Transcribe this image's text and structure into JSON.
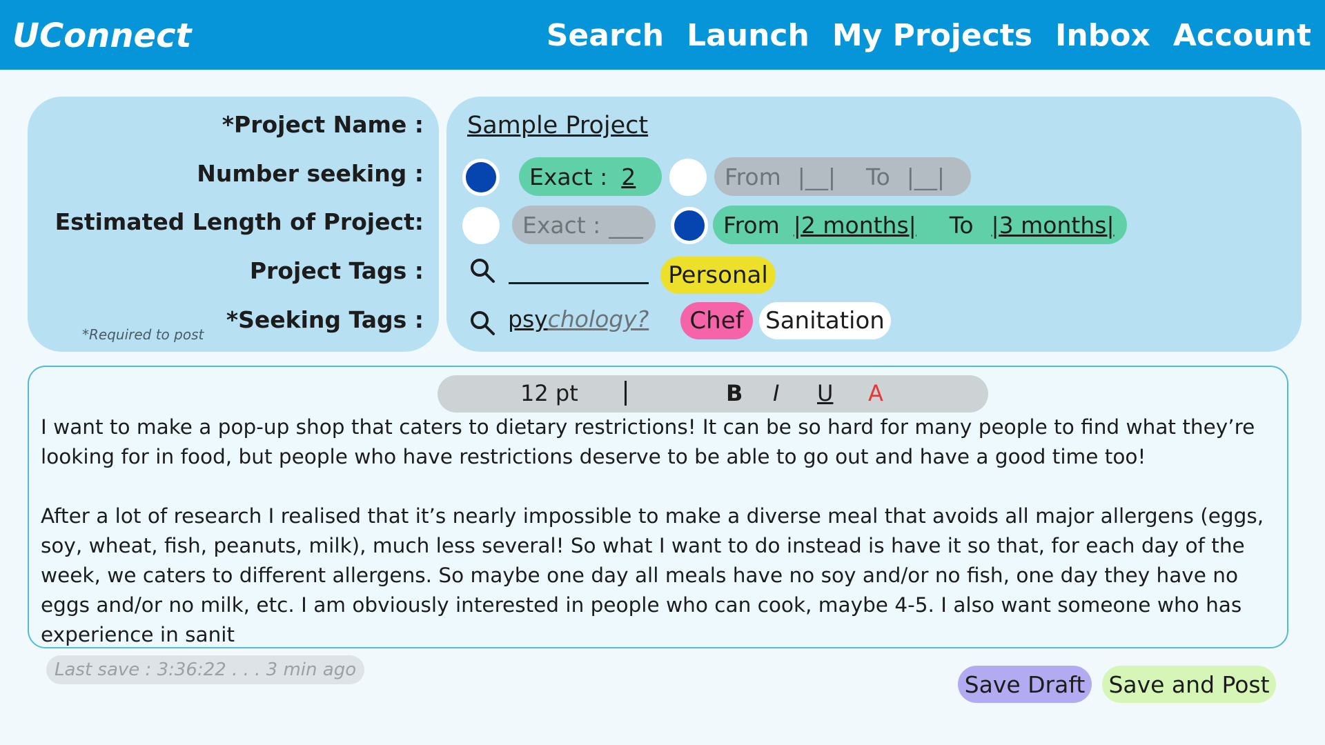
{
  "header": {
    "logo": "UConnect",
    "nav": [
      "Search",
      "Launch",
      "My Projects",
      "Inbox",
      "Account"
    ]
  },
  "labels": {
    "project_name": "*Project Name :",
    "number_seeking": "Number seeking :",
    "length": "Estimated Length of Project:",
    "project_tags": "Project Tags :",
    "seeking_tags": "*Seeking Tags :",
    "required_note": "*Required to post"
  },
  "form": {
    "project_name": "Sample Project",
    "number_seeking": {
      "mode": "exact",
      "exact_label": "Exact :",
      "exact_value": "2",
      "from_label": "From",
      "from_value": "|__|",
      "to_label": "To",
      "to_value": "|__|"
    },
    "length": {
      "mode": "range",
      "exact_label": "Exact :",
      "exact_value": "___",
      "from_label": "From",
      "from_value": "|2 months|",
      "to_label": "To",
      "to_value": "|3 months|"
    },
    "project_tags": {
      "input_value": "",
      "tags": [
        {
          "label": "Personal",
          "color": "#ede02b"
        }
      ]
    },
    "seeking_tags": {
      "typed": "psy",
      "suggestion": "chology?",
      "tags": [
        {
          "label": "Chef",
          "color": "#f563a8"
        },
        {
          "label": "Sanitation",
          "color": "#ffffff"
        }
      ]
    }
  },
  "editor": {
    "toolbar": {
      "font_size": "12 pt",
      "bold": "B",
      "italic": "I",
      "underline": "U",
      "color": "A",
      "color_value": "#e53935"
    },
    "paragraphs": [
      "I want to make a pop-up shop that caters to dietary restrictions! It can be so hard for many people to find what they’re looking for in food, but people who have restrictions deserve to be able to go out and have a good time too!",
      "After a lot of research I realised that it’s nearly impossible to make a diverse meal that avoids all major allergens (eggs, soy, wheat, fish, peanuts, milk), much less several! So what I want to do instead is have it so that, for each day of the week, we caters to different allergens. So maybe one day all meals have no soy and/or no fish, one day they have no eggs and/or no milk, etc. I am obviously interested in people who can cook, maybe 4-5. I also want someone who has experience in sanit"
    ]
  },
  "footer": {
    "last_save": "Last save : 3:36:22 . . . 3 min ago",
    "save_draft": "Save Draft",
    "save_post": "Save and Post"
  },
  "colors": {
    "header": "#0595d8",
    "panel": "#b8e0f3",
    "selected_radio": "#0645b0",
    "active_pill": "#5fd0a8",
    "inactive_pill": "#b3bcc2"
  }
}
